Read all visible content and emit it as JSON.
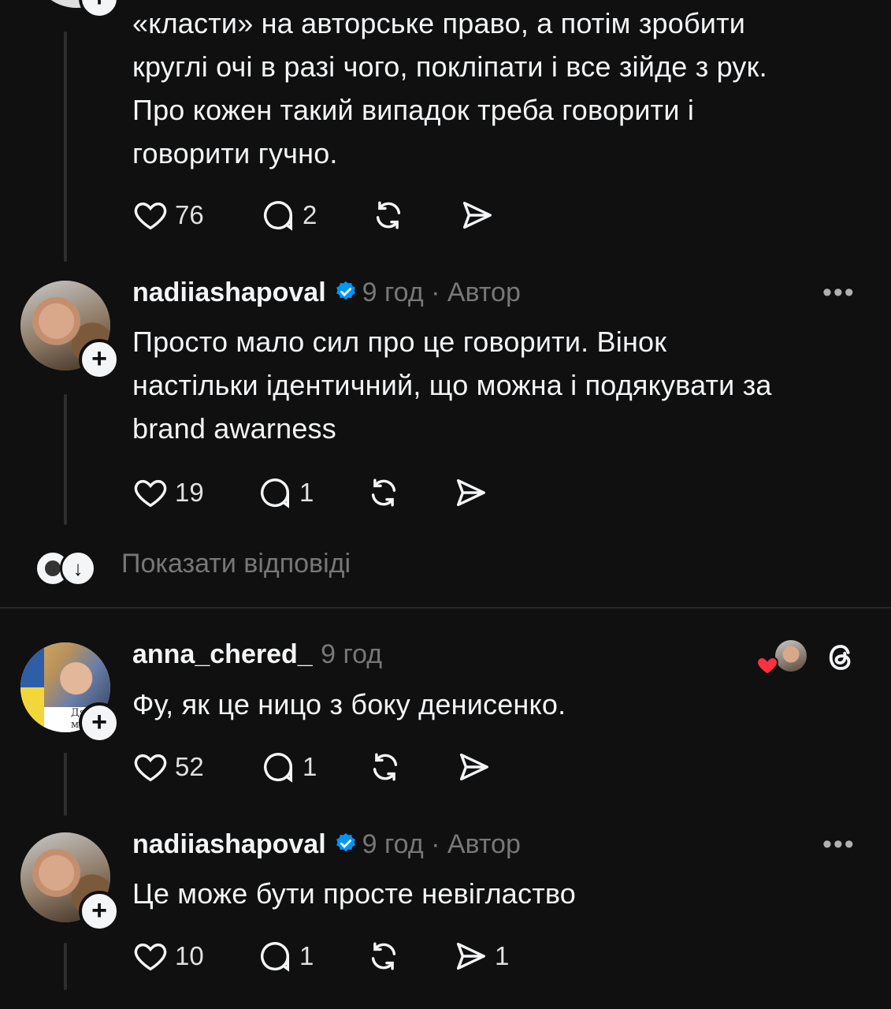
{
  "reply_top": {
    "text_lines": [
      "«класти» на авторське право, а потім зробити",
      "круглі очі в разі чого, поклiпати і все зійде з рук.",
      "Про кожен такий випадок треба говорити і",
      "говорити гучно."
    ],
    "likes": "76",
    "replies": "2"
  },
  "post_author_1": {
    "username": "nadiiashapoval",
    "meta": "9 год · Автор",
    "text_lines": [
      "Просто мало сил про це говорити. Вінок",
      "настільки ідентичний, що можна і подякувати за",
      "brand awarness"
    ],
    "likes": "19",
    "replies": "1"
  },
  "show_replies_label": "Показати відповіді",
  "post_anna": {
    "username": "anna_chered_",
    "meta": "9 год",
    "avatar_badge": "Дяку мам",
    "text": "Фу, як це ницо з боку денисенко.",
    "likes": "52",
    "replies": "1"
  },
  "post_author_2": {
    "username": "nadiiashapoval",
    "meta": "9 год · Автор",
    "text": "Це може бути просте невiгластво",
    "likes": "10",
    "replies": "1",
    "shares": "1"
  },
  "icons": {
    "like": "heart-icon",
    "reply": "comment-bubble-icon",
    "repost": "repost-icon",
    "share": "send-icon",
    "more": "ellipsis-icon",
    "threads": "threads-logo-icon",
    "verified": "verified-badge-icon"
  },
  "colors": {
    "background": "#101010",
    "text": "#f3f5f7",
    "muted": "#777777",
    "verified": "#0095f6",
    "heart": "#ff3040"
  }
}
